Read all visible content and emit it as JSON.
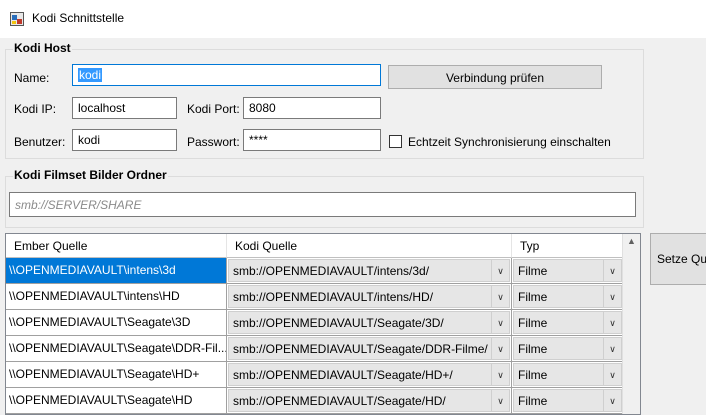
{
  "window": {
    "title": "Kodi Schnittstelle"
  },
  "host_group": {
    "title": "Kodi Host",
    "name_label": "Name:",
    "name_value": "kodi",
    "test_button": "Verbindung prüfen",
    "ip_label": "Kodi IP:",
    "ip_value": "localhost",
    "port_label": "Kodi Port:",
    "port_value": "8080",
    "user_label": "Benutzer:",
    "user_value": "kodi",
    "password_label": "Passwort:",
    "password_value": "****",
    "sync_label": "Echtzeit Synchronisierung einschalten",
    "sync_checked": false
  },
  "movieset_group": {
    "title": "Kodi Filmset Bilder Ordner",
    "path_placeholder": "smb://SERVER/SHARE"
  },
  "grid": {
    "columns": [
      "Ember Quelle",
      "Kodi Quelle",
      "Typ"
    ],
    "rows": [
      {
        "ember": "\\\\OPENMEDIAVAULT\\intens\\3d",
        "kodi": "smb://OPENMEDIAVAULT/intens/3d/",
        "type": "Filme",
        "selected": true
      },
      {
        "ember": "\\\\OPENMEDIAVAULT\\intens\\HD",
        "kodi": "smb://OPENMEDIAVAULT/intens/HD/",
        "type": "Filme",
        "selected": false
      },
      {
        "ember": "\\\\OPENMEDIAVAULT\\Seagate\\3D",
        "kodi": "smb://OPENMEDIAVAULT/Seagate/3D/",
        "type": "Filme",
        "selected": false
      },
      {
        "ember": "\\\\OPENMEDIAVAULT\\Seagate\\DDR-Fil...",
        "kodi": "smb://OPENMEDIAVAULT/Seagate/DDR-Filme/",
        "type": "Filme",
        "selected": false
      },
      {
        "ember": "\\\\OPENMEDIAVAULT\\Seagate\\HD+",
        "kodi": "smb://OPENMEDIAVAULT/Seagate/HD+/",
        "type": "Filme",
        "selected": false
      },
      {
        "ember": "\\\\OPENMEDIAVAULT\\Seagate\\HD",
        "kodi": "smb://OPENMEDIAVAULT/Seagate/HD/",
        "type": "Filme",
        "selected": false
      }
    ]
  },
  "side_button": {
    "label": "Setze Qu"
  },
  "icons": {
    "app": "app-window-icon",
    "dropdown": "chevron-down-icon",
    "scroll_up": "scroll-up-arrow-icon"
  }
}
